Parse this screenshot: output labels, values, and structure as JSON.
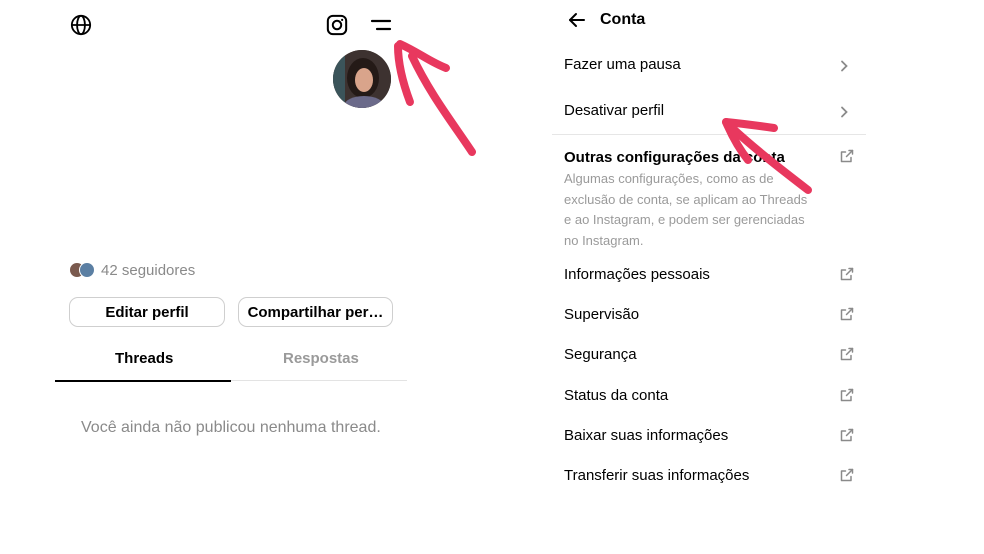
{
  "profile": {
    "followers_text": "42 seguidores",
    "edit_label": "Editar perfil",
    "share_label": "Compartilhar per…",
    "tabs": [
      {
        "label": "Threads",
        "active": true
      },
      {
        "label": "Respostas",
        "active": false
      }
    ],
    "empty_text": "Você ainda não publicou nenhuma thread."
  },
  "account": {
    "title": "Conta",
    "items": [
      {
        "label": "Fazer uma pausa",
        "icon": "chevron-right-icon"
      },
      {
        "label": "Desativar perfil",
        "icon": "chevron-right-icon"
      }
    ],
    "other": {
      "title": "Outras configurações da conta",
      "description": "Algumas configurações, como as de exclusão de conta, se aplicam ao Threads e ao Instagram, e podem ser gerenciadas no Instagram.",
      "icon": "external-link-icon"
    },
    "links": [
      {
        "label": "Informações pessoais",
        "icon": "external-link-icon"
      },
      {
        "label": "Supervisão",
        "icon": "external-link-icon"
      },
      {
        "label": "Segurança",
        "icon": "external-link-icon"
      },
      {
        "label": "Status da conta",
        "icon": "external-link-icon"
      },
      {
        "label": "Baixar suas informações",
        "icon": "external-link-icon"
      },
      {
        "label": "Transferir suas informações",
        "icon": "external-link-icon"
      }
    ]
  },
  "colors": {
    "annotation_arrow": "#e8385e",
    "muted_text": "#8a8a8a"
  }
}
